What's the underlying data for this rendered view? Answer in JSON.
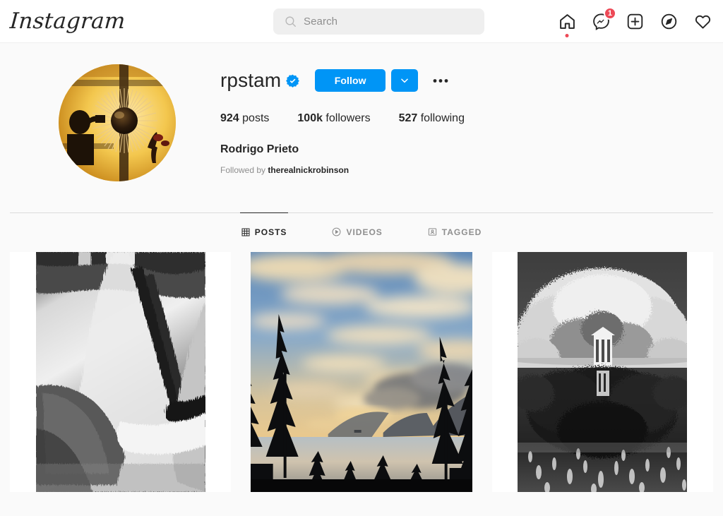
{
  "app": {
    "name": "Instagram",
    "logo_text": "Instagram"
  },
  "search": {
    "placeholder": "Search",
    "value": "",
    "icon": "search-icon"
  },
  "nav_icons": [
    {
      "name": "home-icon",
      "label": "Home",
      "indicator_dot": true
    },
    {
      "name": "messenger-icon",
      "label": "Messenger",
      "badge": "1"
    },
    {
      "name": "new-post-icon",
      "label": "New post"
    },
    {
      "name": "explore-icon",
      "label": "Explore"
    },
    {
      "name": "activity-heart-icon",
      "label": "Activity"
    }
  ],
  "profile": {
    "username": "rpstam",
    "verified": true,
    "verified_icon": "verified-badge-icon",
    "follow_label": "Follow",
    "dropdown_icon": "chevron-down-icon",
    "more_icon": "ellipsis-icon",
    "avatar_alt": "profile-photo",
    "full_name": "Rodrigo Prieto",
    "followed_by_prefix": "Followed by ",
    "followed_by_user": "therealnickrobinson",
    "stats": [
      {
        "count": "924",
        "label": " posts"
      },
      {
        "count": "100k",
        "label": " followers"
      },
      {
        "count": "527",
        "label": " following"
      }
    ]
  },
  "tabs": [
    {
      "id": "posts",
      "label": "POSTS",
      "icon": "grid-icon",
      "active": true
    },
    {
      "id": "videos",
      "label": "VIDEOS",
      "icon": "play-circle-icon",
      "active": false
    },
    {
      "id": "tagged",
      "label": "TAGGED",
      "icon": "tagged-person-icon",
      "active": false
    }
  ],
  "posts": [
    {
      "id": "post-1",
      "alt": "black-and-white canal water reflection"
    },
    {
      "id": "post-2",
      "alt": "sunset over lake framed by pine trees"
    },
    {
      "id": "post-3",
      "alt": "black-and-white gazebo reflected in pond"
    }
  ],
  "colors": {
    "accent_blue": "#0095f6",
    "notification_red": "#ed4956",
    "text_primary": "#262626",
    "text_secondary": "#8e8e8e",
    "page_background": "#fafafa",
    "surface": "#ffffff",
    "border": "#dbdbdb",
    "search_background": "#efefef"
  }
}
